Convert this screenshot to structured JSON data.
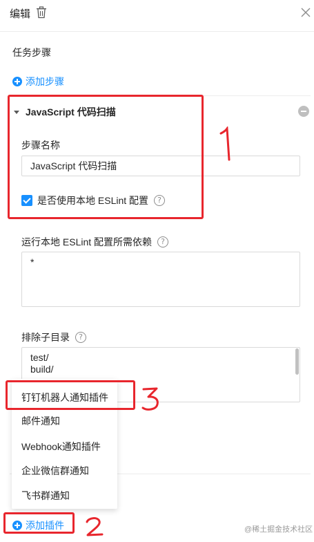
{
  "header": {
    "title": "编辑"
  },
  "task_steps": {
    "title": "任务步骤",
    "add_step_label": "添加步骤"
  },
  "step": {
    "name": "JavaScript 代码扫描",
    "name_field_label": "步骤名称",
    "name_field_value": "JavaScript 代码扫描",
    "eslint_checkbox_label": "是否使用本地 ESLint 配置",
    "eslint_checkbox_checked": true,
    "deps_label": "运行本地 ESLint 配置所需依赖",
    "deps_value": "*",
    "exclude_label": "排除子目录",
    "exclude_value": "test/\nbuild/"
  },
  "help_icon": "?",
  "plugin_menu": {
    "items": [
      "钉钉机器人通知插件",
      "邮件通知",
      "Webhook通知插件",
      "企业微信群通知",
      "飞书群通知"
    ]
  },
  "add_plugin_label": "添加插件",
  "annotations": {
    "first": "1",
    "second": "2",
    "third": "3"
  },
  "watermark": "@稀土掘金技术社区",
  "colors": {
    "accent": "#1890ff",
    "annotation": "#e8262d"
  }
}
